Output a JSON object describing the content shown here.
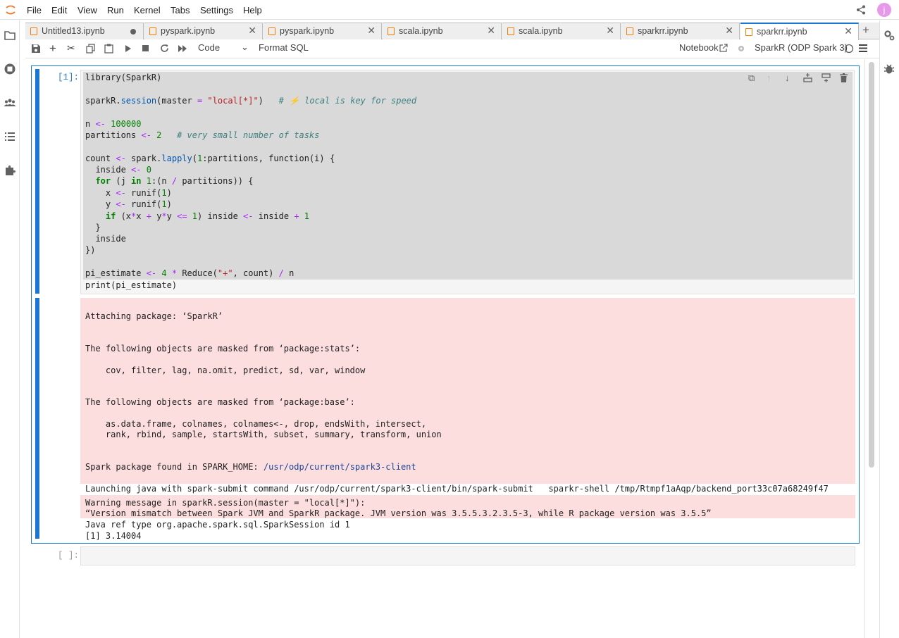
{
  "menubar": {
    "items": [
      "File",
      "Edit",
      "View",
      "Run",
      "Kernel",
      "Tabs",
      "Settings",
      "Help"
    ],
    "user_initial": "j"
  },
  "tabs": [
    {
      "label": "Untitled13.ipynb",
      "modified": true
    },
    {
      "label": "pyspark.ipynb"
    },
    {
      "label": "pyspark.ipynb"
    },
    {
      "label": "scala.ipynb"
    },
    {
      "label": "scala.ipynb"
    },
    {
      "label": "sparkrr.ipynb"
    },
    {
      "label": "sparkrr.ipynb",
      "active": true
    }
  ],
  "toolbar": {
    "cell_type": "Code",
    "format_sql": "Format SQL",
    "notebook": "Notebook",
    "kernel_name": "SparkR (ODP Spark 3)"
  },
  "cell1": {
    "prompt": "[1]:",
    "output": {
      "attaching": "Attaching package: ‘SparkR’",
      "masked_stats": "The following objects are masked from ‘package:stats’:",
      "masked_stats_list": "    cov, filter, lag, na.omit, predict, sd, var, window",
      "masked_base": "The following objects are masked from ‘package:base’:",
      "masked_base_list1": "    as.data.frame, colnames, colnames<-, drop, endsWith, intersect,",
      "masked_base_list2": "    rank, rbind, sample, startsWith, subset, summary, transform, union",
      "spark_home_prefix": "Spark package found in SPARK_HOME: ",
      "spark_home_path": "/usr/odp/current/spark3-client",
      "launching": "Launching java with spark-submit command /usr/odp/current/spark3-client/bin/spark-submit   sparkr-shell /tmp/Rtmpf1aAqp/backend_port33c07a68249f47",
      "warning1": "Warning message in sparkR.session(master = \"local[*]\"):",
      "warning2": "“Version mismatch between Spark JVM and SparkR package. JVM version was 3.5.5.3.2.3.5-3, while R package version was 3.5.5”",
      "java_ref": "Java ref type org.apache.spark.sql.SparkSession id 1",
      "result": "[1] 3.14004"
    }
  },
  "cell2": {
    "prompt": "[ ]:"
  }
}
